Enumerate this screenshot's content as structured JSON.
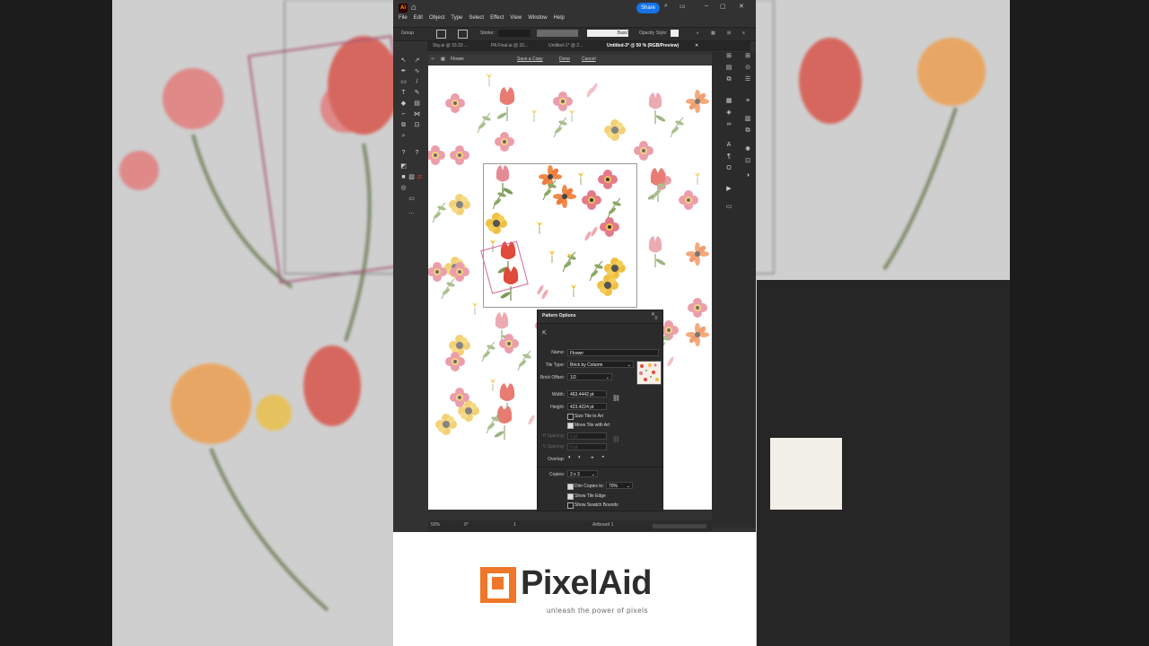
{
  "menubar": {
    "app_icon": "Ai",
    "share_label": "Share",
    "menus": [
      "File",
      "Edit",
      "Object",
      "Type",
      "Select",
      "Effect",
      "View",
      "Window",
      "Help"
    ]
  },
  "control_bar": {
    "selection": "Group",
    "stroke_label": "Stroke:",
    "brush_label": "Basic",
    "opacity_label": "Opacity",
    "style_label": "Style:"
  },
  "tabs": [
    {
      "label": "Sky.ai @ 33.33 ..."
    },
    {
      "label": "PA Final.ai @ 33..."
    },
    {
      "label": "Untitled-1* @ 2..."
    },
    {
      "label": "Untitled-3* @ 50 % (RGB/Preview)"
    }
  ],
  "pattern_bar": {
    "name": "Flower",
    "save_copy": "Save a Copy",
    "done": "Done",
    "cancel": "Cancel"
  },
  "pattern_options": {
    "title": "Pattern Options",
    "name_label": "Name:",
    "name_value": "Flower",
    "tile_type_label": "Tile Type:",
    "tile_type_value": "Brick by Column",
    "brick_offset_label": "Brick Offset:",
    "brick_offset_value": "1/2",
    "width_label": "Width:",
    "width_value": "463.4442 pt",
    "height_label": "Height:",
    "height_value": "423.4224 pt",
    "size_tile_label": "Size Tile to Art",
    "move_tile_label": "Move Tile with Art",
    "h_spacing_label": "H Spacing:",
    "v_spacing_label": "V Spacing:",
    "spacing_value": "0 pt",
    "overlap_label": "Overlap:",
    "copies_label": "Copies:",
    "copies_value": "3 x 3",
    "dim_copies_label": "Dim Copies to:",
    "dim_copies_value": "70%",
    "show_tile_edge_label": "Show Tile Edge",
    "show_swatch_bounds_label": "Show Swatch Bounds"
  },
  "status_bar": {
    "zoom": "50%",
    "rotation": "0°",
    "artboard_num": "1",
    "artboard_label": "Artboard 1"
  },
  "brand": {
    "name": "PixelAid",
    "tagline": "unleash the power of pixels",
    "accent": "#ee7728"
  }
}
